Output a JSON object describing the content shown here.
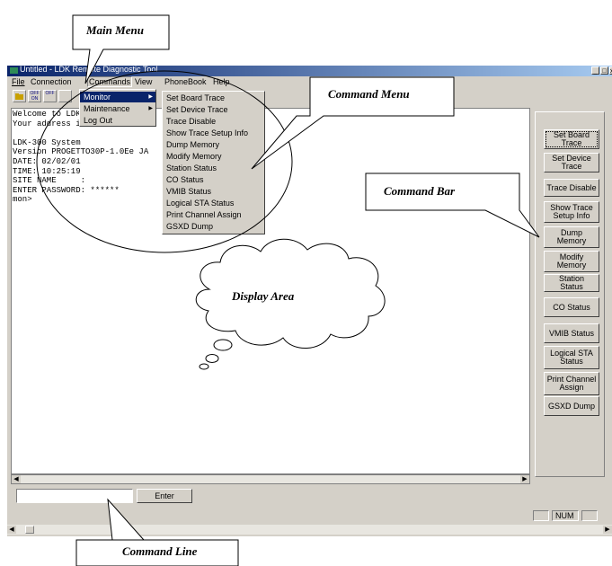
{
  "window": {
    "title": "Untitled - LDK Remote Diagnostic Tool",
    "controls": [
      "_",
      "□",
      "x"
    ]
  },
  "menubar": [
    "File",
    "Connection",
    "Commands",
    "View",
    "PhoneBook",
    "Help"
  ],
  "toolbar": [
    {
      "label": "",
      "icon": "open-icon"
    },
    {
      "label": "OFF ON",
      "icon": "connect-icon"
    },
    {
      "label": "OFF",
      "icon": "disconnect-icon"
    },
    {
      "label": "",
      "icon": "tool-icon"
    }
  ],
  "commands_menu": {
    "items": [
      {
        "label": "Monitor",
        "submenu": true,
        "selected": true
      },
      {
        "label": "Maintenance",
        "submenu": true,
        "selected": false
      },
      {
        "label": "Log Out",
        "submenu": false,
        "selected": false
      }
    ]
  },
  "monitor_submenu": [
    "Set Board Trace",
    "Set Device Trace",
    "Trace Disable",
    "Show Trace Setup Info",
    "Dump Memory",
    "Modify Memory",
    "Station Status",
    "CO Status",
    "VMIB Status",
    "Logical STA Status",
    "Print Channel Assign",
    "GSXD Dump"
  ],
  "console_lines": [
    "Welcome to LDK",
    "Your address i                         is 6",
    "",
    "LDK-300 System",
    "Version PROGETTO30P-1.0Ee JA",
    "DATE: 02/02/01",
    "TIME: 10:25:19",
    "SITE NAME     :",
    "ENTER PASSWORD: ******",
    "mon>"
  ],
  "command_bar": [
    "Set Board Trace",
    "Set Device Trace",
    "Trace Disable",
    "Show Trace Setup Info",
    "Dump Memory",
    "Modify Memory",
    "Station Status",
    "CO Status",
    "VMIB Status",
    "Logical STA Status",
    "Print Channel Assign",
    "GSXD Dump"
  ],
  "command_line": {
    "value": "",
    "enter_label": "Enter"
  },
  "statusbar": {
    "num": "NUM"
  },
  "callouts": {
    "main_menu": "Main Menu",
    "command_menu": "Command Menu",
    "command_bar": "Command Bar",
    "display_area": "Display Area",
    "command_line": "Command Line"
  }
}
